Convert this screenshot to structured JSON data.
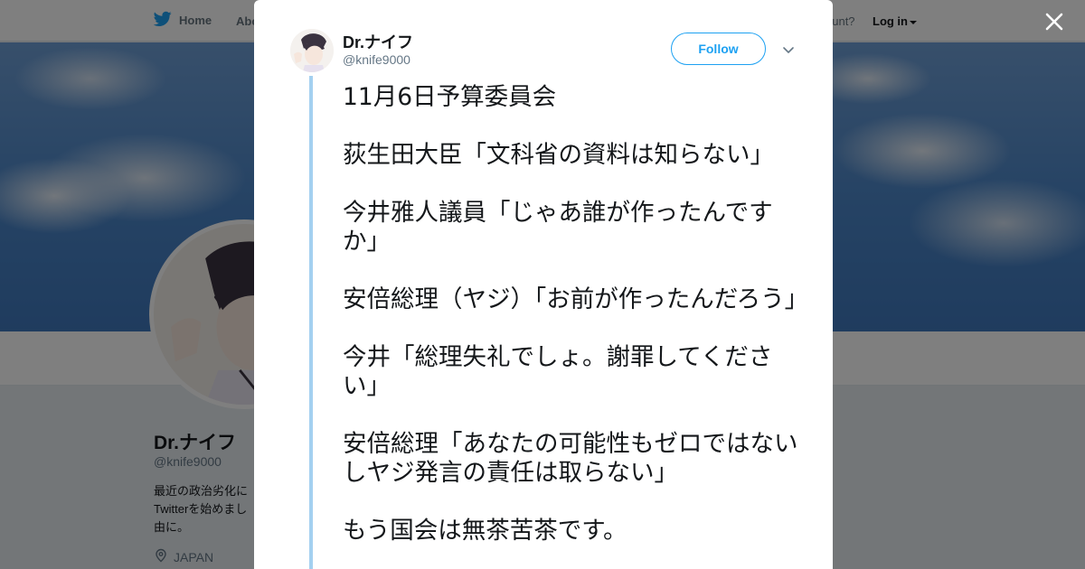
{
  "nav": {
    "home_label": "Home",
    "about_label": "Abo",
    "account_prompt": "ccount?",
    "login_label": "Log in"
  },
  "profile": {
    "name": "Dr.ナイフ",
    "handle": "@knife9000",
    "bio_lines": [
      "最近の政治劣化に",
      "Twitterを始めまし",
      "由に。"
    ],
    "location": "JAPAN"
  },
  "tweet": {
    "author_name": "Dr.ナイフ",
    "author_handle": "@knife9000",
    "follow_label": "Follow",
    "paragraphs": [
      "11月6日予算委員会",
      "荻生田大臣「文科省の資料は知らない」",
      "今井雅人議員「じゃあ誰が作ったんですか」",
      "安倍総理（ヤジ）「お前が作ったんだろう」",
      "今井「総理失礼でしょ。謝罪してください」",
      "安倍総理「あなたの可能性もゼロではないしヤジ発言の責任は取らない」",
      "もう国会は無茶苦茶です。"
    ]
  },
  "icons": {
    "nav_logo": "bird-icon",
    "close": "close-icon",
    "more": "chevron-down-icon",
    "location": "location-pin-icon"
  },
  "colors": {
    "accent": "#1da1f2",
    "thread_line": "#a4d0f0",
    "text": "#14171a",
    "muted": "#657786"
  }
}
